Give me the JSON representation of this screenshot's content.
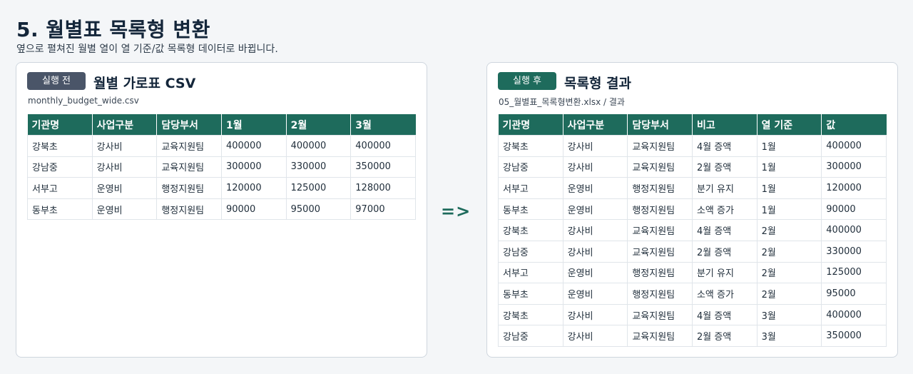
{
  "header": {
    "title": "5. 월별표 목록형 변환",
    "subtitle": "옆으로 펼쳐진 월별 열이 열 기준/값 목록형 데이터로 바뀝니다."
  },
  "left_panel": {
    "badge": "실행 전",
    "title": "월별 가로표 CSV",
    "filename": "monthly_budget_wide.csv",
    "columns": [
      "기관명",
      "사업구분",
      "담당부서",
      "1월",
      "2월",
      "3월"
    ],
    "rows": [
      [
        "강북초",
        "강사비",
        "교육지원팀",
        "400000",
        "400000",
        "400000"
      ],
      [
        "강남중",
        "강사비",
        "교육지원팀",
        "300000",
        "330000",
        "350000"
      ],
      [
        "서부고",
        "운영비",
        "행정지원팀",
        "120000",
        "125000",
        "128000"
      ],
      [
        "동부초",
        "운영비",
        "행정지원팀",
        "90000",
        "95000",
        "97000"
      ]
    ]
  },
  "arrow": "=>",
  "right_panel": {
    "badge": "실행 후",
    "title": "목록형 결과",
    "filename": "05_월별표_목록형변환.xlsx / 결과",
    "columns": [
      "기관명",
      "사업구분",
      "담당부서",
      "비고",
      "열 기준",
      "값"
    ],
    "rows": [
      [
        "강북초",
        "강사비",
        "교육지원팀",
        "4월 증액",
        "1월",
        "400000"
      ],
      [
        "강남중",
        "강사비",
        "교육지원팀",
        "2월 증액",
        "1월",
        "300000"
      ],
      [
        "서부고",
        "운영비",
        "행정지원팀",
        "분기 유지",
        "1월",
        "120000"
      ],
      [
        "동부초",
        "운영비",
        "행정지원팀",
        "소액 증가",
        "1월",
        "90000"
      ],
      [
        "강북초",
        "강사비",
        "교육지원팀",
        "4월 증액",
        "2월",
        "400000"
      ],
      [
        "강남중",
        "강사비",
        "교육지원팀",
        "2월 증액",
        "2월",
        "330000"
      ],
      [
        "서부고",
        "운영비",
        "행정지원팀",
        "분기 유지",
        "2월",
        "125000"
      ],
      [
        "동부초",
        "운영비",
        "행정지원팀",
        "소액 증가",
        "2월",
        "95000"
      ],
      [
        "강북초",
        "강사비",
        "교육지원팀",
        "4월 증액",
        "3월",
        "400000"
      ],
      [
        "강남중",
        "강사비",
        "교육지원팀",
        "2월 증액",
        "3월",
        "350000"
      ]
    ]
  },
  "colors": {
    "accent": "#1e6b5c",
    "badge_before": "#4a5568",
    "title": "#14263a"
  }
}
